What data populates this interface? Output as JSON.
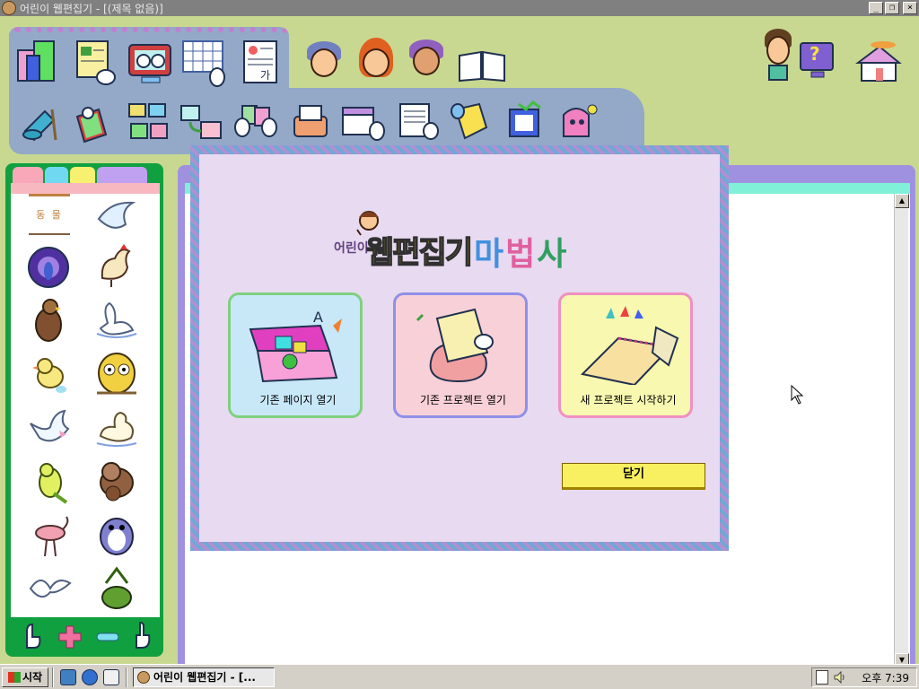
{
  "window": {
    "title": "어린이 웹편집기 - [(제목 없음)]",
    "controls": {
      "minimize": "_",
      "restore": "❐",
      "close": "×"
    }
  },
  "toolbar": {
    "top_icons": [
      "folder-books-icon",
      "page-hand-icon",
      "monitor-glasses-icon",
      "grid-hand-icon",
      "page-text-icon"
    ],
    "characters": [
      "boy-character-icon",
      "girl-character-icon",
      "cap-boy-character-icon",
      "book-icon"
    ],
    "right_icons": [
      "thinking-boy-icon",
      "help-monitor-icon",
      "house-icon"
    ],
    "help_glyph": "?",
    "bottom_icons": [
      "magic-hat-icon",
      "notebook-icon",
      "link-pages-icon",
      "monitor-link-icon",
      "hands-cards-icon",
      "printer-icon",
      "folder-hand-icon",
      "document-icon",
      "yellow-tag-icon",
      "frame-icon",
      "pink-robot-icon"
    ]
  },
  "sidebar": {
    "tab_colors": [
      "#f8a8b8",
      "#70d8f0",
      "#f8f070",
      "#c0a0f0"
    ],
    "header_label": "동 물",
    "birds": [
      "dove",
      "peacock",
      "rooster",
      "eagle",
      "swan",
      "chick",
      "owl",
      "flying-dove",
      "duck",
      "parrot",
      "sparrow",
      "flamingo",
      "penguin",
      "seagull",
      "plant-bird"
    ],
    "bottom_icons": [
      "hand-pointer-left-icon",
      "plus-icon",
      "minus-icon",
      "hand-pointer-right-icon"
    ]
  },
  "wizard": {
    "logo_small": "어린이",
    "logo_big": "웹편집기",
    "logo_magic": [
      "마",
      "법",
      "사"
    ],
    "logo_magic_colors": [
      "#4090e0",
      "#e060a0",
      "#30a060"
    ],
    "cards": [
      {
        "label": "기존 페이지 열기",
        "bg": "#c8e8f8",
        "border": "#80d080"
      },
      {
        "label": "기존 프로젝트 열기",
        "bg": "#f8d0d8",
        "border": "#9090e8"
      },
      {
        "label": "새 프로젝트 시작하기",
        "bg": "#f8f8b0",
        "border": "#f090c0"
      }
    ],
    "close_label": "닫기"
  },
  "taskbar": {
    "start_label": "시작",
    "task_label": "어린이 웹편집기 - [...",
    "clock": "오후 7:39"
  }
}
